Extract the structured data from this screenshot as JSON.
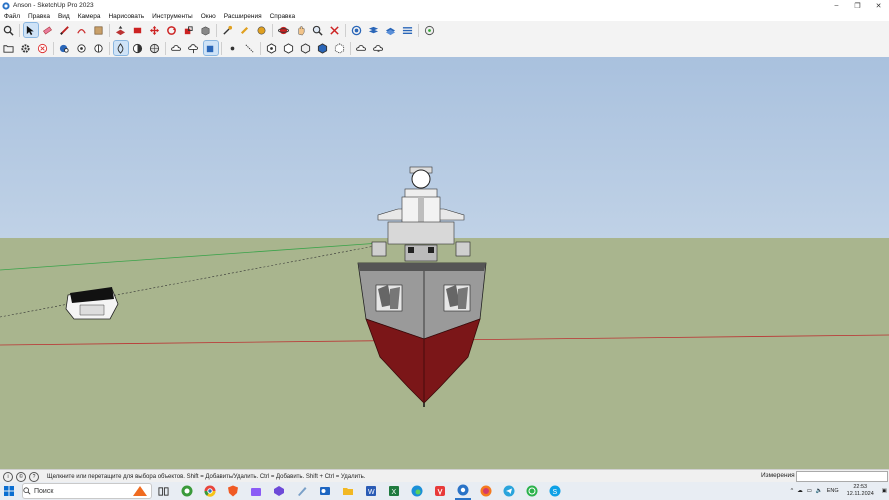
{
  "window": {
    "title": "Anson - SketchUp Pro 2023"
  },
  "menu": [
    "Файл",
    "Правка",
    "Вид",
    "Камера",
    "Нарисовать",
    "Инструменты",
    "Окно",
    "Расширения",
    "Справка"
  ],
  "toolbar_row1_icons": [
    "search-icon",
    "select-arrow-icon",
    "eraser-icon",
    "pencil-icon",
    "arc-icon",
    "paint-bucket-icon",
    "push-pull-icon",
    "follow-me-icon",
    "move-icon",
    "rotate-icon",
    "scale-icon",
    "offset-icon",
    "tape-measure-icon",
    "paint-icon",
    "orbit-icon",
    "pan-icon",
    "zoom-icon",
    "zoom-extents-icon",
    "section-plane-icon",
    "layers-icon",
    "components-icon",
    "styles-icon",
    "extension-icon"
  ],
  "toolbar_row2_icons": [
    "open-folder-icon",
    "settings-gear-icon",
    "cancel-icon",
    "view-iso-icon",
    "view-top-icon",
    "view-front-icon",
    "xray-icon",
    "backedge-icon",
    "hidden-line-icon",
    "cloud-upload-icon",
    "cloud-download-icon",
    "shaded-icon",
    "point-icon",
    "line-icon",
    "hex-1-icon",
    "hex-2-icon",
    "hex-3-icon",
    "hex-4-icon",
    "hex-5-icon",
    "cloud-share-icon",
    "cloud-sync-icon"
  ],
  "statusbar": {
    "help_text": "Щелкните или перетащите для выбора объектов. Shift = Добавить/Удалить. Ctrl = Добавить. Shift + Ctrl = Удалить.",
    "measure_label": "Измерения",
    "measure_value": ""
  },
  "taskbar": {
    "search_placeholder": "Поиск",
    "apps": [
      "file-explorer-icon",
      "task-view-icon",
      "chrome-icon",
      "brave-icon",
      "store-icon",
      "edge-icon",
      "settings-app-icon",
      "folder-app-icon",
      "word-icon",
      "excel-icon",
      "edge-browser-icon",
      "vivaldi-icon",
      "sketchup-icon",
      "firefox-icon",
      "telegram-icon",
      "whatsapp-icon",
      "skype-icon"
    ],
    "lang": "ENG",
    "time": "22:53",
    "date": "12.11.2024"
  },
  "colors": {
    "hull_red": "#7b1618",
    "hull_grey": "#9a9a9a",
    "ground": "#a9b58e",
    "sky_top": "#a9c1de",
    "sky_bottom": "#dde7f1"
  }
}
